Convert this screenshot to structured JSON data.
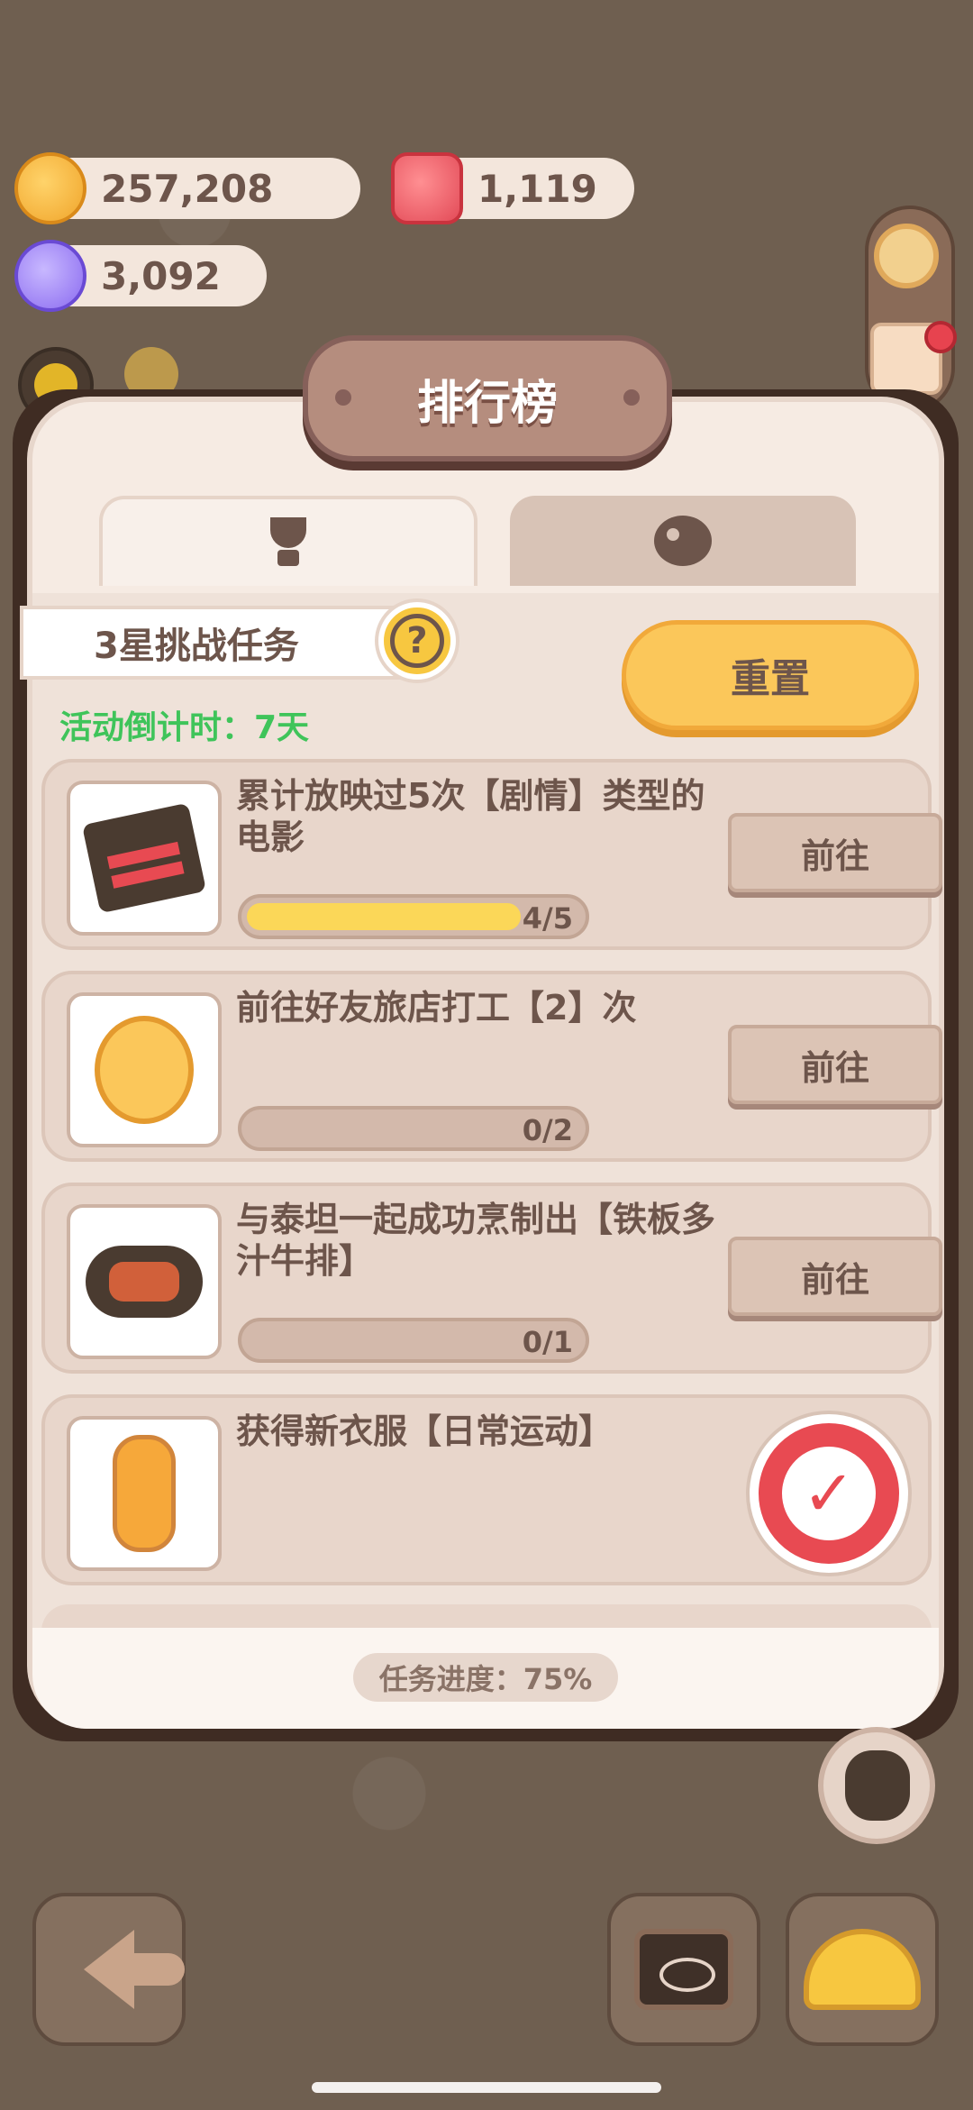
{
  "currencies": {
    "cookies": "257,208",
    "gems": "1,119",
    "candy": "3,092"
  },
  "panel": {
    "title": "排行榜",
    "challenge_label": "3星挑战任务",
    "help_symbol": "?",
    "countdown": "活动倒计时：7天",
    "reset_label": "重置",
    "progress_text": "任务进度：75%"
  },
  "tasks": [
    {
      "desc": "累计放映过5次【剧情】类型的电影",
      "progress_label": "4/5",
      "progress": 0.8,
      "button": "前往",
      "icon": "clapperboard-icon"
    },
    {
      "desc": "前往好友旅店打工【2】次",
      "progress_label": "0/2",
      "progress": 0.0,
      "button": "前往",
      "icon": "worker-girl-icon"
    },
    {
      "desc": "与泰坦一起成功烹制出【铁板多汁牛排】",
      "progress_label": "0/1",
      "progress": 0.0,
      "button": "前往",
      "icon": "steak-icon"
    },
    {
      "desc": "获得新衣服【日常运动】",
      "completed": true,
      "check_symbol": "✓",
      "icon": "outfit-icon"
    }
  ]
}
